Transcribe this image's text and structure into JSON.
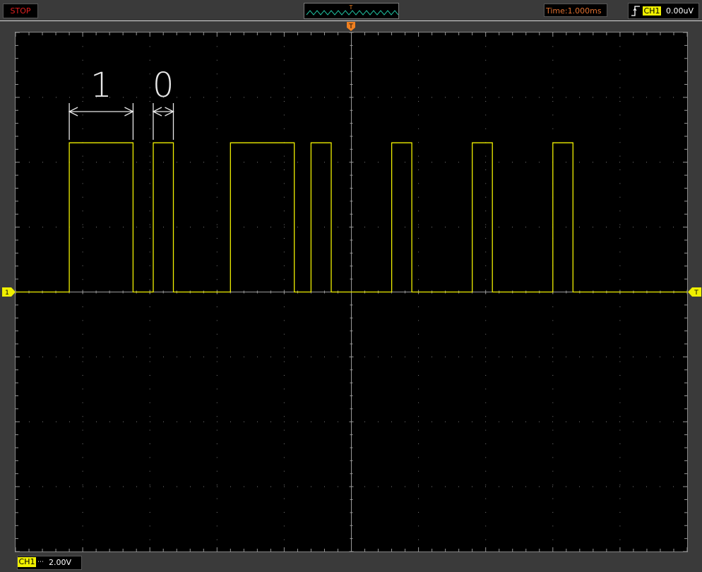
{
  "status": {
    "run_state": "STOP"
  },
  "timebase": {
    "label": "Time:1.000ms"
  },
  "trigger": {
    "channel": "CH1",
    "level": "0.00uV",
    "edge_icon": "rising-edge-icon",
    "marker": "T"
  },
  "channel1": {
    "label": "CH1",
    "coupling_icon": "dc-coupling-icon",
    "volts_per_div": "2.00V",
    "ground_marker": "1"
  },
  "annotations": {
    "bit_one": "1",
    "bit_zero": "0"
  },
  "colors": {
    "trace": "#f0f000",
    "trigger_marker": "#f08020",
    "background": "#000000",
    "frame": "#3a3a3a",
    "stop_text": "#e02020",
    "time_text": "#e07030",
    "minimap_wave": "#20c0a0"
  },
  "chart_data": {
    "type": "line",
    "title": "",
    "xlabel": "",
    "ylabel": "",
    "x_unit": "ms",
    "y_unit": "V",
    "xlim": [
      -5.0,
      5.0
    ],
    "ylim": [
      -8.0,
      8.0
    ],
    "grid": true,
    "series": [
      {
        "x": [
          -5.0,
          -4.2,
          -4.2,
          -3.25,
          -3.25,
          -2.95,
          -2.95,
          -2.65,
          -2.65,
          -1.8,
          -1.8,
          -0.85,
          -0.85,
          -0.6,
          -0.6,
          -0.3,
          -0.3,
          0.6,
          0.6,
          0.9,
          0.9,
          1.8,
          1.8,
          2.1,
          2.1,
          3.0,
          3.0,
          3.3,
          3.3,
          5.0
        ],
        "y": [
          0,
          0,
          4.6,
          4.6,
          0,
          0,
          4.6,
          4.6,
          0,
          0,
          4.6,
          4.6,
          0,
          0,
          4.6,
          4.6,
          0,
          0,
          4.6,
          4.6,
          0,
          0,
          4.6,
          4.6,
          0,
          0,
          4.6,
          4.6,
          0,
          0
        ]
      }
    ]
  }
}
